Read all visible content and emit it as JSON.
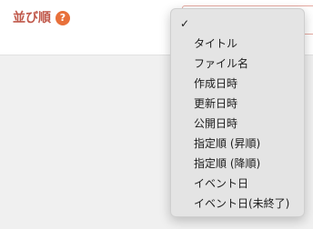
{
  "field": {
    "label": "並び順",
    "help_icon_glyph": "?"
  },
  "colors": {
    "label": "#c0584a",
    "help_icon": "#e8703a"
  },
  "menu": {
    "check_glyph": "✓",
    "items": [
      {
        "label": "",
        "selected": true
      },
      {
        "label": "タイトル",
        "selected": false
      },
      {
        "label": "ファイル名",
        "selected": false
      },
      {
        "label": "作成日時",
        "selected": false
      },
      {
        "label": "更新日時",
        "selected": false
      },
      {
        "label": "公開日時",
        "selected": false
      },
      {
        "label": "指定順 (昇順)",
        "selected": false
      },
      {
        "label": "指定順 (降順)",
        "selected": false
      },
      {
        "label": "イベント日",
        "selected": false
      },
      {
        "label": "イベント日(未終了)",
        "selected": false
      }
    ]
  }
}
